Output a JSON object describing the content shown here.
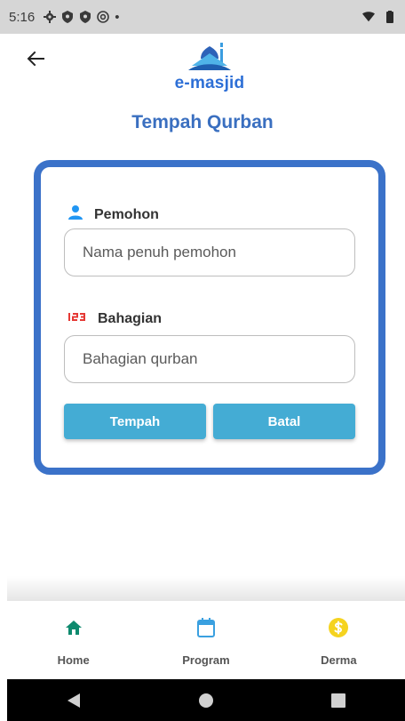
{
  "status_bar": {
    "time": "5:16",
    "dot": "•"
  },
  "header": {
    "back_icon": "arrow-left-icon",
    "logo_text": "e-masjid",
    "title": "Tempah Qurban"
  },
  "form": {
    "applicant_label": "Pemohon",
    "applicant_icon": "person-icon",
    "applicant_placeholder": "Nama penuh pemohon",
    "portion_label": "Bahagian",
    "portion_icon": "numbers-123-icon",
    "portion_placeholder": "Bahagian qurban",
    "submit_label": "Tempah",
    "cancel_label": "Batal"
  },
  "bottom_nav": {
    "items": [
      {
        "label": "Home",
        "icon": "home-icon"
      },
      {
        "label": "Program",
        "icon": "calendar-icon"
      },
      {
        "label": "Derma",
        "icon": "dollar-coin-icon"
      }
    ]
  },
  "colors": {
    "accent_blue": "#3b72c9",
    "button": "#44acd4",
    "home_green": "#0e8a6e",
    "program_blue": "#3aa0e0",
    "derma_yellow": "#f5d31f"
  }
}
